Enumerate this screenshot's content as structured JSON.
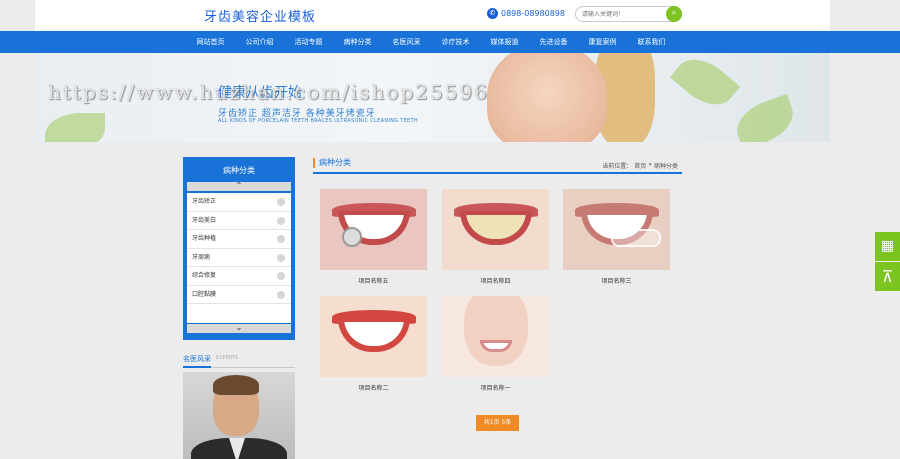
{
  "header": {
    "logo": "牙齿美容企业模板",
    "phone": "0898-08980898",
    "search_placeholder": "请输入关键词！"
  },
  "nav": {
    "items": [
      "网站首页",
      "公司介绍",
      "活动专题",
      "病种分类",
      "名医风采",
      "诊疗技术",
      "媒体报道",
      "先进设备",
      "康复案例",
      "联系我们"
    ]
  },
  "banner": {
    "title": "健康从齿开始",
    "subtitle": "牙齿矫正   超声洁牙   各种美牙烤瓷牙",
    "english": "ALL KINDS OF PORCELAIN TEETH BRACES ULTRASONIC CLEANING TEETH",
    "watermark": "https://www.huzhan.com/ishop25596"
  },
  "sidebar": {
    "category_title": "病种分类",
    "categories": [
      "牙齿矫正",
      "牙齿美白",
      "牙齿种植",
      "牙周病",
      "综合修复",
      "口腔黏膜"
    ],
    "doctors_title": "名医风采",
    "doctors_en": "EXPERTS"
  },
  "main": {
    "title": "病种分类",
    "breadcrumb_prefix": "当前位置：",
    "breadcrumb_home": "首页",
    "breadcrumb_sep": "»",
    "breadcrumb_current": "病种分类",
    "products": [
      {
        "caption": "项目名称五"
      },
      {
        "caption": "项目名称四"
      },
      {
        "caption": "项目名称三"
      },
      {
        "caption": "项目名称二"
      },
      {
        "caption": "项目名称一"
      }
    ],
    "pager": "共1页 5条"
  },
  "colors": {
    "brand_blue": "#1872d8",
    "accent_green": "#7cc41f",
    "accent_orange": "#f08a24"
  }
}
